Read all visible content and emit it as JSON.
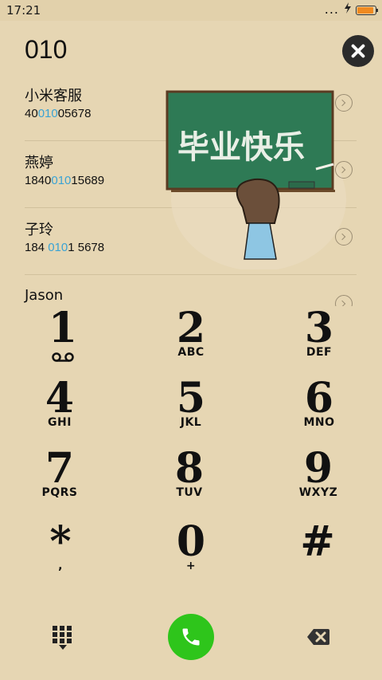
{
  "status_bar": {
    "time": "17:21",
    "dots": "...",
    "charge_icon": "charging-bolt-icon",
    "battery_color": "#f08a1f"
  },
  "dialer": {
    "number": "010"
  },
  "results": [
    {
      "name": "小米客服",
      "phone_before": "40",
      "phone_match": "010",
      "phone_after": "05678"
    },
    {
      "name": "燕婷",
      "phone_before": "1840",
      "phone_match": "010",
      "phone_after": "15689"
    },
    {
      "name": "子玲",
      "phone_before": "184 ",
      "phone_match": "010",
      "phone_after": "1 5678"
    },
    {
      "name": "Jason"
    }
  ],
  "artwork": {
    "chalkboard_text": "毕业快乐"
  },
  "keypad": [
    {
      "digit": "1",
      "letters": ""
    },
    {
      "digit": "2",
      "letters": "ABC"
    },
    {
      "digit": "3",
      "letters": "DEF"
    },
    {
      "digit": "4",
      "letters": "GHI"
    },
    {
      "digit": "5",
      "letters": "JKL"
    },
    {
      "digit": "6",
      "letters": "MNO"
    },
    {
      "digit": "7",
      "letters": "PQRS"
    },
    {
      "digit": "8",
      "letters": "TUV"
    },
    {
      "digit": "9",
      "letters": "WXYZ"
    },
    {
      "digit": "*",
      "letters": ","
    },
    {
      "digit": "0",
      "letters": "+"
    },
    {
      "digit": "#",
      "letters": ""
    }
  ],
  "colors": {
    "background": "#e6d6b3",
    "highlight": "#3aa3d4",
    "call": "#2ec51b"
  }
}
